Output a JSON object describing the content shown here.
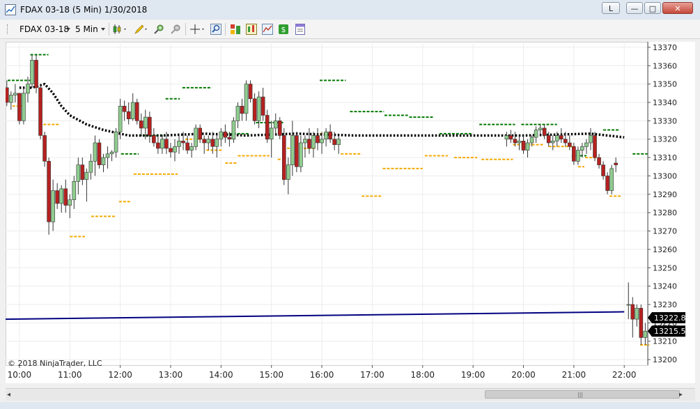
{
  "window": {
    "title": "FDAX 03-18 (5 Min)  1/30/2018",
    "btn_l": "L",
    "btn_min": "—",
    "btn_max": "□",
    "btn_close": "✕"
  },
  "toolbar": {
    "instrument": "FDAX 03-18",
    "interval": "5 Min",
    "icons": [
      "candlestick-chart-icon",
      "pencil-draw-icon",
      "zoom-in-icon",
      "zoom-out-icon",
      "crosshair-icon",
      "magnifier-icon",
      "data-box-icon",
      "indicators-icon",
      "strategies-icon",
      "chart-trader-icon",
      "properties-icon"
    ]
  },
  "copyright": "© 2018 NinjaTrader, LLC",
  "colors": {
    "up": "#8fcc8f",
    "down": "#b5211f",
    "green_level": "#007800",
    "orange_level": "#f5a800",
    "vwap": "#000000",
    "blue_line": "#000080"
  },
  "scrollbar": {
    "left_arrow": "◂",
    "right_arrow": "▸",
    "grip": "|||"
  },
  "chart_data": {
    "type": "candlestick",
    "ylim": [
      13197,
      13373
    ],
    "y_ticks": [
      13200,
      13210,
      13220,
      13230,
      13240,
      13250,
      13260,
      13270,
      13280,
      13290,
      13300,
      13310,
      13320,
      13330,
      13340,
      13350,
      13360,
      13370
    ],
    "x_ticks": [
      {
        "label": "10:00",
        "t": 0
      },
      {
        "label": "11:00",
        "t": 12
      },
      {
        "label": "12:00",
        "t": 24
      },
      {
        "label": "13:00",
        "t": 36
      },
      {
        "label": "14:00",
        "t": 48
      },
      {
        "label": "15:00",
        "t": 60
      },
      {
        "label": "16:00",
        "t": 72
      },
      {
        "label": "17:00",
        "t": 84
      },
      {
        "label": "18:00",
        "t": 96
      },
      {
        "label": "19:00",
        "t": 108
      },
      {
        "label": "20:00",
        "t": 120
      },
      {
        "label": "21:00",
        "t": 132
      },
      {
        "label": "22:00",
        "t": 144
      }
    ],
    "x_range": [
      -3.3,
      149.6
    ],
    "grid": true,
    "price_markers": [
      {
        "label": "13222.8",
        "value": 13222.8
      },
      {
        "label": "13215.5",
        "value": 13215.5
      }
    ],
    "bars_group1": [
      [
        13348,
        13352,
        13338,
        13340
      ],
      [
        13340,
        13346,
        13336,
        13344
      ],
      [
        13344,
        13350,
        13340,
        13345
      ],
      [
        13345,
        13345,
        13328,
        13330
      ],
      [
        13330,
        13348,
        13328,
        13345
      ],
      [
        13345,
        13354,
        13340,
        13350
      ],
      [
        13350,
        13366,
        13348,
        13363
      ],
      [
        13363,
        13366,
        13345,
        13348
      ],
      [
        13348,
        13350,
        13320,
        13322
      ],
      [
        13322,
        13324,
        13305,
        13308
      ],
      [
        13308,
        13310,
        13268,
        13275
      ],
      [
        13275,
        13298,
        13270,
        13292
      ],
      [
        13292,
        13296,
        13282,
        13285
      ],
      [
        13285,
        13295,
        13280,
        13293
      ],
      [
        13293,
        13298,
        13280,
        13284
      ],
      [
        13284,
        13290,
        13277,
        13287
      ],
      [
        13287,
        13300,
        13282,
        13297
      ],
      [
        13297,
        13310,
        13290,
        13306
      ],
      [
        13306,
        13310,
        13295,
        13298
      ],
      [
        13298,
        13304,
        13286,
        13302
      ],
      [
        13302,
        13312,
        13298,
        13308
      ],
      [
        13308,
        13322,
        13300,
        13318
      ],
      [
        13318,
        13320,
        13304,
        13306
      ],
      [
        13306,
        13312,
        13302,
        13310
      ],
      [
        13310,
        13316,
        13304,
        13312
      ],
      [
        13312,
        13314,
        13308,
        13313
      ],
      [
        13313,
        13326,
        13310,
        13324
      ],
      [
        13324,
        13342,
        13320,
        13338
      ],
      [
        13338,
        13341,
        13330,
        13335
      ],
      [
        13335,
        13340,
        13328,
        13331
      ],
      [
        13331,
        13345,
        13330,
        13340
      ],
      [
        13340,
        13342,
        13328,
        13330
      ],
      [
        13330,
        13334,
        13322,
        13326
      ],
      [
        13326,
        13336,
        13320,
        13332
      ],
      [
        13332,
        13335,
        13318,
        13322
      ],
      [
        13322,
        13326,
        13316,
        13318
      ],
      [
        13318,
        13322,
        13312,
        13315
      ],
      [
        13315,
        13322,
        13312,
        13320
      ],
      [
        13320,
        13324,
        13312,
        13315
      ],
      [
        13315,
        13318,
        13310,
        13313
      ],
      [
        13313,
        13320,
        13308,
        13316
      ],
      [
        13316,
        13322,
        13312,
        13319
      ],
      [
        13319,
        13324,
        13314,
        13318
      ],
      [
        13318,
        13322,
        13312,
        13314
      ],
      [
        13314,
        13318,
        13310,
        13316
      ],
      [
        13316,
        13328,
        13314,
        13326
      ],
      [
        13326,
        13328,
        13318,
        13320
      ],
      [
        13320,
        13322,
        13312,
        13318
      ],
      [
        13318,
        13322,
        13314,
        13320
      ],
      [
        13320,
        13324,
        13312,
        13316
      ],
      [
        13316,
        13322,
        13310,
        13320
      ],
      [
        13320,
        13326,
        13316,
        13324
      ],
      [
        13324,
        13328,
        13318,
        13321
      ],
      [
        13321,
        13324,
        13316,
        13320
      ],
      [
        13320,
        13332,
        13318,
        13330
      ],
      [
        13330,
        13340,
        13326,
        13338
      ],
      [
        13338,
        13342,
        13330,
        13334
      ],
      [
        13334,
        13352,
        13330,
        13350
      ],
      [
        13350,
        13352,
        13340,
        13342
      ],
      [
        13342,
        13345,
        13328,
        13330
      ],
      [
        13330,
        13346,
        13326,
        13343
      ],
      [
        13343,
        13348,
        13330,
        13333
      ],
      [
        13333,
        13336,
        13318,
        13320
      ],
      [
        13320,
        13330,
        13310,
        13326
      ],
      [
        13326,
        13334,
        13322,
        13330
      ],
      [
        13330,
        13332,
        13320,
        13322
      ],
      [
        13322,
        13326,
        13295,
        13298
      ],
      [
        13298,
        13310,
        13290,
        13306
      ],
      [
        13306,
        13330,
        13300,
        13322
      ],
      [
        13322,
        13324,
        13302,
        13305
      ],
      [
        13305,
        13322,
        13302,
        13318
      ],
      [
        13318,
        13322,
        13310,
        13320
      ],
      [
        13320,
        13326,
        13312,
        13315
      ],
      [
        13315,
        13324,
        13310,
        13322
      ],
      [
        13322,
        13326,
        13314,
        13318
      ],
      [
        13318,
        13324,
        13312,
        13320
      ],
      [
        13320,
        13326,
        13316,
        13324
      ],
      [
        13324,
        13328,
        13318,
        13320
      ],
      [
        13320,
        13324,
        13314,
        13317
      ],
      [
        13317,
        13322,
        13312,
        13320
      ]
    ],
    "bars_group2": [
      [
        13320,
        13324,
        13316,
        13322
      ],
      [
        13322,
        13325,
        13318,
        13320
      ],
      [
        13320,
        13324,
        13316,
        13318
      ],
      [
        13318,
        13322,
        13314,
        13319
      ],
      [
        13319,
        13322,
        13312,
        13314
      ],
      [
        13314,
        13320,
        13310,
        13318
      ],
      [
        13318,
        13322,
        13316,
        13321
      ],
      [
        13321,
        13327,
        13318,
        13325
      ],
      [
        13325,
        13328,
        13322,
        13326
      ],
      [
        13326,
        13328,
        13320,
        13322
      ],
      [
        13322,
        13324,
        13316,
        13318
      ],
      [
        13318,
        13322,
        13314,
        13319
      ],
      [
        13319,
        13324,
        13316,
        13322
      ],
      [
        13322,
        13326,
        13318,
        13320
      ],
      [
        13320,
        13324,
        13316,
        13318
      ],
      [
        13318,
        13322,
        13314,
        13316
      ],
      [
        13316,
        13318,
        13306,
        13308
      ],
      [
        13308,
        13316,
        13306,
        13314
      ],
      [
        13314,
        13318,
        13310,
        13316
      ],
      [
        13316,
        13320,
        13312,
        13318
      ],
      [
        13318,
        13326,
        13314,
        13322
      ],
      [
        13322,
        13324,
        13308,
        13310
      ],
      [
        13310,
        13312,
        13304,
        13306
      ],
      [
        13306,
        13308,
        13298,
        13300
      ],
      [
        13300,
        13302,
        13290,
        13292
      ],
      [
        13292,
        13306,
        13290,
        13304
      ],
      [
        13307,
        13310,
        13302,
        13306
      ]
    ],
    "bars_group3": [
      [
        13230,
        13242,
        13222,
        13230
      ],
      [
        13230,
        13234,
        13212,
        13222
      ],
      [
        13222,
        13230,
        13218,
        13228
      ],
      [
        13228,
        13230,
        13208,
        13212
      ],
      [
        13212,
        13220,
        13208,
        13215.5
      ]
    ],
    "vwap": [
      [
        0,
        13348
      ],
      [
        3,
        13348
      ],
      [
        6,
        13350
      ],
      [
        8,
        13345
      ],
      [
        10,
        13338
      ],
      [
        12,
        13333
      ],
      [
        16,
        13328
      ],
      [
        20,
        13325
      ],
      [
        26,
        13322
      ],
      [
        34,
        13322
      ],
      [
        44,
        13323
      ],
      [
        54,
        13322
      ],
      [
        66,
        13323
      ],
      [
        80,
        13322
      ],
      [
        100,
        13322
      ],
      [
        120,
        13322
      ],
      [
        136,
        13323
      ],
      [
        144,
        13321
      ]
    ],
    "blue_line": [
      [
        -3.3,
        13222
      ],
      [
        144,
        13226
      ]
    ],
    "green_levels": [
      [
        -2.8,
        2.8,
        13352
      ],
      [
        2.6,
        6.9,
        13366
      ],
      [
        24.2,
        28.4,
        13312
      ],
      [
        28.5,
        34.5,
        13322
      ],
      [
        34.8,
        38.2,
        13342
      ],
      [
        38.8,
        45.8,
        13348
      ],
      [
        48.9,
        54.8,
        13323
      ],
      [
        56.3,
        62.8,
        13329
      ],
      [
        71.5,
        77.7,
        13352
      ],
      [
        78.7,
        86.8,
        13335
      ],
      [
        86.9,
        92.5,
        13333
      ],
      [
        92.8,
        98.5,
        13332
      ],
      [
        100,
        108,
        13323
      ],
      [
        109.5,
        118,
        13328
      ],
      [
        119.5,
        128,
        13328
      ],
      [
        131.5,
        135,
        13311
      ],
      [
        139,
        143,
        13325
      ],
      [
        146,
        149.5,
        13312
      ]
    ],
    "orange_levels": [
      [
        -1.7,
        1,
        13338
      ],
      [
        5.7,
        9.7,
        13328
      ],
      [
        12,
        15.6,
        13267
      ],
      [
        17.1,
        23.1,
        13278
      ],
      [
        23.7,
        26.4,
        13286
      ],
      [
        27.2,
        37.7,
        13301
      ],
      [
        39.5,
        43.5,
        13320
      ],
      [
        44.5,
        48.5,
        13314
      ],
      [
        49,
        52,
        13307
      ],
      [
        52,
        59.5,
        13311
      ],
      [
        61.5,
        62.5,
        13309
      ],
      [
        63.7,
        70.6,
        13315
      ],
      [
        71.5,
        74.5,
        13323
      ],
      [
        76.5,
        81.5,
        13312
      ],
      [
        81.5,
        86.5,
        13289
      ],
      [
        86.5,
        96,
        13304
      ],
      [
        96.5,
        102,
        13311
      ],
      [
        103.5,
        109,
        13310
      ],
      [
        110,
        117.5,
        13309
      ],
      [
        117.5,
        121,
        13317
      ],
      [
        121,
        125,
        13317
      ],
      [
        126,
        132,
        13316
      ],
      [
        133,
        134.5,
        13305
      ],
      [
        134.7,
        137.7,
        13310
      ],
      [
        140.5,
        143.5,
        13289
      ],
      [
        147.8,
        150,
        13208
      ]
    ]
  }
}
